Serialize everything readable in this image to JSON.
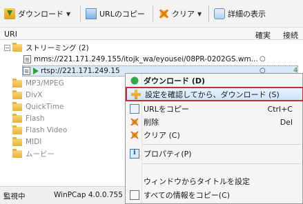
{
  "toolbar": {
    "download": "ダウンロード",
    "url_copy": "URLのコピー",
    "clear": "クリア",
    "details": "詳細の表示"
  },
  "columns": {
    "uri": "URI",
    "certain": "確実",
    "connect": "接続"
  },
  "tree": {
    "streaming": "ストリーミング (2)",
    "item1": "mms://221.171.249.155/itojk_wa/eyousei/08PR-0202GS.wm...",
    "item1_status": "○",
    "item2": "rtsp://221.171.249.15",
    "item2_status": "○",
    "item2_trail": "4",
    "folders": [
      "MP3/MPEG",
      "DivX",
      "QuickTime",
      "Flash",
      "Flash Video",
      "MIDI",
      "ムービー"
    ]
  },
  "status": {
    "mode": "監視中",
    "pcap": "WinPCap 4.0.0.755"
  },
  "menu": {
    "download": "ダウンロード (D)",
    "confirm_download": "設定を確認してから、ダウンロード (S)",
    "url_copy": "URLをコピー",
    "url_copy_shortcut": "Ctrl+C",
    "delete": "削除",
    "delete_shortcut": "Del",
    "clear": "クリア (C)",
    "properties": "プロパティ(P)",
    "set_title": "ウィンドウからタイトルを設定",
    "copy_all": "すべての情報をコピー(C)"
  }
}
